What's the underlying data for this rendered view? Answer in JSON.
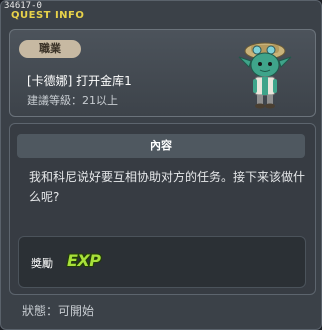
{
  "window": {
    "id_text": "34617-0",
    "title": "QUEST INFO"
  },
  "header": {
    "category": "職業",
    "quest_name": "[卡德娜] 打开金库1",
    "level": "建議等級：21以上"
  },
  "content": {
    "heading": "內容",
    "description": "我和科尼说好要互相协助对方的任务。接下来该做什么呢?"
  },
  "reward": {
    "label": "獎勵",
    "exp_text": "EXP"
  },
  "status": {
    "text": "狀態：可開始"
  },
  "colors": {
    "title": "#e8d24a",
    "exp": "#a8e13a",
    "badge": "#c7b9a2"
  }
}
